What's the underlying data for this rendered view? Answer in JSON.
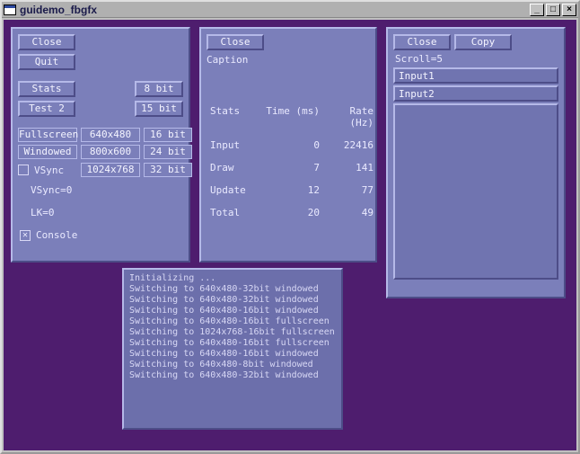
{
  "window": {
    "title": "guidemo_fbgfx",
    "btn_min": "_",
    "btn_max": "□",
    "btn_close": "×"
  },
  "left": {
    "close": "Close",
    "quit": "Quit",
    "stats": "Stats",
    "test2": "Test 2",
    "bit8": "8 bit",
    "bit15": "15 bit",
    "fullscreen": "Fullscreen",
    "windowed": "Windowed",
    "res640": "640x480",
    "res800": "800x600",
    "res1024": "1024x768",
    "bit16": "16 bit",
    "bit24": "24 bit",
    "bit32": "32 bit",
    "vsync_label": "VSync",
    "vsync_status": "VSync=0",
    "lk_status": "LK=0",
    "console_label": "Console"
  },
  "mid": {
    "close": "Close",
    "caption": "Caption",
    "hdr_stats": "Stats",
    "hdr_time": "Time (ms)",
    "hdr_rate": "Rate (Hz)",
    "rows": [
      {
        "name": "Input",
        "time": "0",
        "rate": "22416"
      },
      {
        "name": "Draw",
        "time": "7",
        "rate": "141"
      },
      {
        "name": "Update",
        "time": "12",
        "rate": "77"
      },
      {
        "name": "Total",
        "time": "20",
        "rate": "49"
      }
    ]
  },
  "right": {
    "close": "Close",
    "copy": "Copy",
    "scroll": "Scroll=5",
    "input1": "Input1",
    "input2": "Input2"
  },
  "console": {
    "lines": [
      "Initializing ...",
      "Switching to 640x480-32bit windowed",
      "Switching to 640x480-32bit windowed",
      "Switching to 640x480-16bit windowed",
      "Switching to 640x480-16bit fullscreen",
      "Switching to 1024x768-16bit fullscreen",
      "Switching to 640x480-16bit fullscreen",
      "Switching to 640x480-16bit windowed",
      "Switching to 640x480-8bit windowed",
      "Switching to 640x480-32bit windowed"
    ]
  }
}
